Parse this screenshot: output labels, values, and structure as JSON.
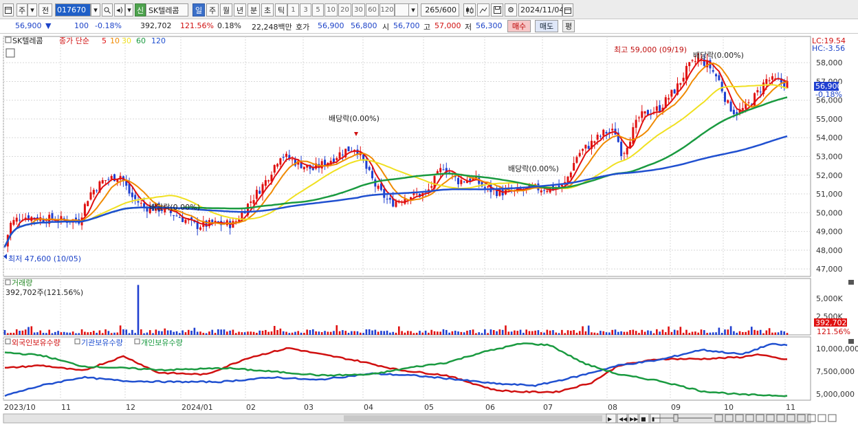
{
  "toolbar": {
    "period_type": "주",
    "prev_label": "전",
    "stock_code": "017670",
    "new_badge": "신",
    "stock_name": "SK텔레콤",
    "periods": [
      "일",
      "주",
      "월",
      "년",
      "분",
      "초",
      "틱"
    ],
    "active_period": "일",
    "interval_numbers": [
      "1",
      "3",
      "5",
      "10",
      "20",
      "30",
      "60",
      "120"
    ],
    "count": "265",
    "count_max": "/600",
    "date": "2024/11/04"
  },
  "info": {
    "price": "56,900",
    "change_arrow": "▼",
    "change": "100",
    "change_pct": "-0.18%",
    "volume": "392,702",
    "vol_ratio": "121.56%",
    "turnover": "0.18%",
    "amount": "22,248백만",
    "bid_label": "호가",
    "ask_price": "56,900",
    "bid_price": "56,800",
    "open_label": "시",
    "open": "56,700",
    "high_label": "고",
    "high": "57,000",
    "low_label": "저",
    "low": "56,300",
    "buy_label": "매수",
    "sell_label": "매도",
    "eval_label": "평"
  },
  "price_panel": {
    "stock_tag": "SK텔레콤",
    "ma_label": "종가 단순",
    "ma_periods": [
      "5",
      "10",
      "30",
      "60",
      "120"
    ],
    "ma_colors": [
      "#e01010",
      "#f08a00",
      "#f0e020",
      "#1a9a40",
      "#2050d0"
    ],
    "lc": "LC:19.54",
    "hc": "HC:-3.56",
    "current_price": "56,900",
    "current_change": "-0.18%",
    "high_note": "최고 59,000 (09/19)",
    "low_note": "최저 47,600 (10/05)",
    "dividend_label": "배당락(0.00%)",
    "y_ticks": [
      "58,000",
      "57,000",
      "56,000",
      "55,000",
      "54,000",
      "53,000",
      "52,000",
      "51,000",
      "50,000",
      "49,000",
      "48,000",
      "47,000"
    ]
  },
  "volume_panel": {
    "title": "거래량",
    "value": "392,702주(121.56%)",
    "y_ticks": [
      "5,000K",
      "2,500K"
    ],
    "current": "392,702",
    "current_pct": "121.56%"
  },
  "holding_panel": {
    "series": [
      "외국인보유수량",
      "기관보유수량",
      "개인보유수량"
    ],
    "colors": [
      "#d01010",
      "#2050d0",
      "#1a9a40"
    ],
    "y_ticks": [
      "10,000,000",
      "7,500,000",
      "5,000,000"
    ]
  },
  "x_axis": [
    "2023/10",
    "11",
    "12",
    "2024/01",
    "02",
    "03",
    "04",
    "05",
    "06",
    "07",
    "08",
    "09",
    "10",
    "11"
  ]
}
